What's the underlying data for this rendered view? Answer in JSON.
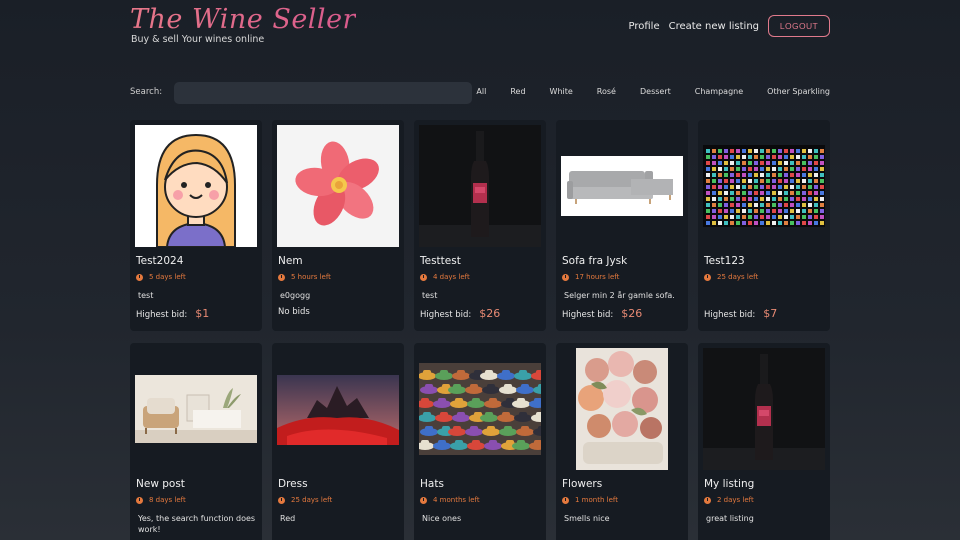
{
  "header": {
    "title": "The Wine Seller",
    "subtitle": "Buy & sell Your wines online",
    "nav": {
      "profile": "Profile",
      "create": "Create new listing",
      "logout": "LOGOUT"
    }
  },
  "search": {
    "label": "Search:",
    "value": "",
    "filters": [
      "All",
      "Red",
      "White",
      "Rosé",
      "Dessert",
      "Champagne",
      "Other Sparkling"
    ]
  },
  "listings": [
    {
      "title": "Test2024",
      "time": "5 days left",
      "desc": "test",
      "bid_label": "Highest bid:",
      "bid": "$1",
      "image": "cartoon-girl-avatar"
    },
    {
      "title": "Nem",
      "time": "5 hours left",
      "desc": "e0gogg",
      "bid_label": "No bids",
      "bid": "",
      "image": "pink-flower"
    },
    {
      "title": "Testtest",
      "time": "4 days left",
      "desc": "test",
      "bid_label": "Highest bid:",
      "bid": "$26",
      "image": "wine-bottle"
    },
    {
      "title": "Sofa fra Jysk",
      "time": "17 hours left",
      "desc": "Selger min 2 år gamle sofa.",
      "bid_label": "Highest bid:",
      "bid": "$26",
      "image": "grey-sofa"
    },
    {
      "title": "Test123",
      "time": "25 days left",
      "desc": "",
      "bid_label": "Highest bid:",
      "bid": "$7",
      "image": "sprite-collage"
    },
    {
      "title": "New post",
      "time": "8 days left",
      "desc": "Yes, the search function does work!",
      "image": "living-room"
    },
    {
      "title": "Dress",
      "time": "25 days left",
      "desc": "Red",
      "image": "red-dress-landscape"
    },
    {
      "title": "Hats",
      "time": "4 months left",
      "desc": "Nice ones",
      "image": "colorful-hats"
    },
    {
      "title": "Flowers",
      "time": "1 month left",
      "desc": "Smells nice",
      "image": "flower-bouquet"
    },
    {
      "title": "My listing",
      "time": "2 days left",
      "desc": "great listing",
      "image": "wine-bottle"
    }
  ],
  "colors": {
    "accent": "#e07a8c",
    "time": "#e4793e",
    "bid": "#e88a74",
    "card": "#161b22"
  }
}
